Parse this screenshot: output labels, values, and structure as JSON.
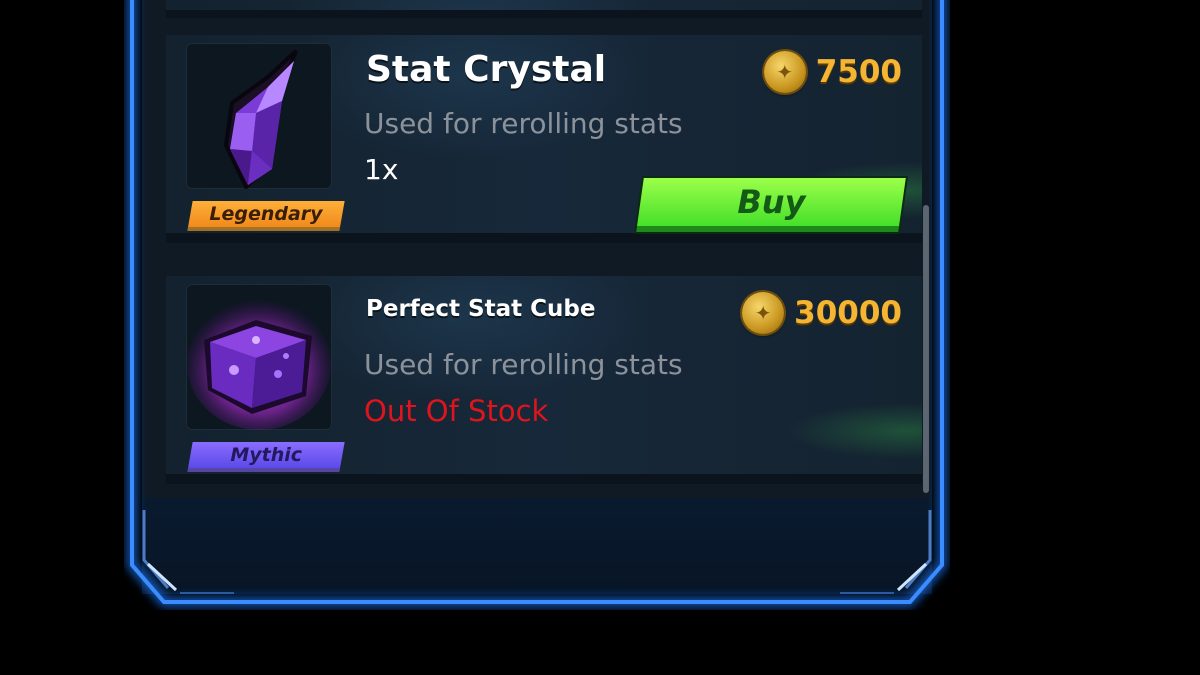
{
  "shop": {
    "items": [
      {
        "name": "Stat Crystal",
        "description": "Used for rerolling stats",
        "quantity": "1x",
        "price": "7500",
        "rarity": "Legendary",
        "icon": "purple-crystal-icon",
        "action_label": "Buy"
      },
      {
        "name": "Perfect Stat Cube",
        "description": "Used for rerolling stats",
        "status": "Out Of Stock",
        "price": "30000",
        "rarity": "Mythic",
        "icon": "purple-cube-icon"
      }
    ]
  },
  "colors": {
    "frame_glow": "#1e78ff",
    "price_gold": "#f5b533",
    "buy_green": "#5be832",
    "out_of_stock_red": "#e0141c",
    "legendary_orange": "#f59a26",
    "mythic_purple": "#6f5af2"
  }
}
